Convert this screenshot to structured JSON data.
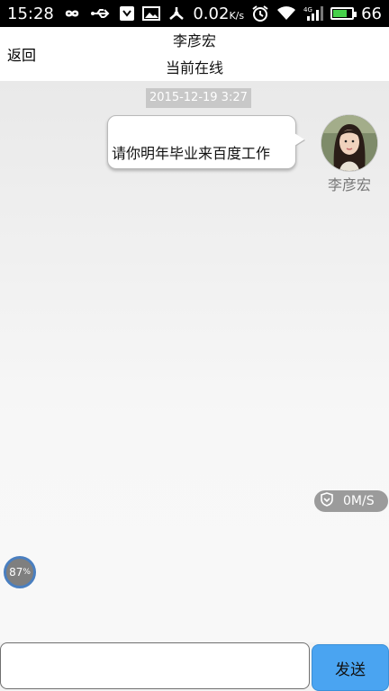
{
  "status_bar": {
    "time": "15:28",
    "data_speed": "0.02",
    "data_speed_unit": "K/s",
    "battery_level": "66",
    "battery_fraction": 0.66,
    "battery_color": "#46d04a",
    "left_icons": [
      "infinity-icon",
      "usb-icon",
      "notification-icon",
      "image-icon",
      "share-icon"
    ],
    "right_icons": [
      "alarm-icon",
      "wifi-icon",
      "signal-icon",
      "battery-icon"
    ]
  },
  "header": {
    "back_label": "返回",
    "contact_name": "李彦宏",
    "contact_status": "当前在线"
  },
  "chat": {
    "messages": [
      {
        "timestamp": "2015-12-19 3:27",
        "text": "请你明年毕业来百度工作",
        "sender": "李彦宏",
        "side": "right"
      }
    ]
  },
  "overlay": {
    "network_speed": "0M/S",
    "percent": "87",
    "percent_unit": "%"
  },
  "input_bar": {
    "value": "",
    "placeholder": "",
    "send_label": "发送",
    "send_color": "#4aa4f1"
  }
}
